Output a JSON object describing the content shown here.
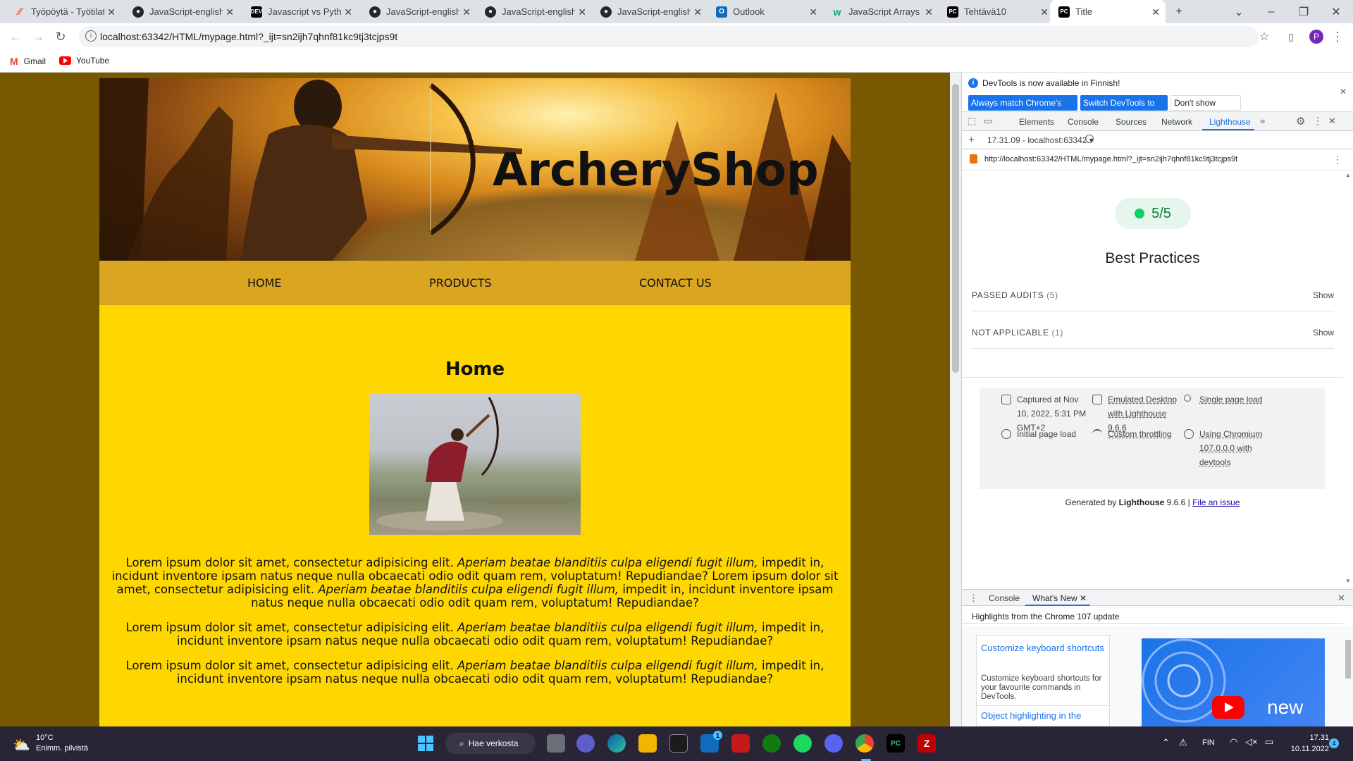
{
  "browser": {
    "tabs": [
      {
        "title": "Työpöytä - Työtilat",
        "icon": "trello-icon"
      },
      {
        "title": "JavaScript-english/",
        "icon": "github-icon"
      },
      {
        "title": "Javascript vs Python",
        "icon": "dev-icon"
      },
      {
        "title": "JavaScript-english/",
        "icon": "github-icon"
      },
      {
        "title": "JavaScript-english/",
        "icon": "github-icon"
      },
      {
        "title": "JavaScript-english/",
        "icon": "github-icon"
      },
      {
        "title": "Outlook",
        "icon": "outlook-icon"
      },
      {
        "title": "JavaScript Arrays",
        "icon": "w3schools-icon"
      },
      {
        "title": "Tehtävä10",
        "icon": "pycharm-icon"
      },
      {
        "title": "Title",
        "icon": "pycharm-icon"
      }
    ],
    "url": "localhost:63342/HTML/mypage.html?_ijt=sn2ijh7qhnf81kc9tj3tcjps9t",
    "profile_initial": "P",
    "bookmarks": [
      {
        "label": "Gmail",
        "icon": "gmail-icon"
      },
      {
        "label": "YouTube",
        "icon": "youtube-icon"
      }
    ]
  },
  "site": {
    "banner_title": "ArcheryShop",
    "nav": [
      "HOME",
      "PRODUCTS",
      "CONTACT US"
    ],
    "heading": "Home",
    "para_start": "Lorem ipsum dolor sit amet, consectetur adipisicing elit. ",
    "para_italic": "Aperiam beatae blanditiis culpa eligendi fugit illum,",
    "para_end": " impedit in, incidunt inventore ipsam natus neque nulla obcaecati odio odit quam rem, voluptatum! Repudiandae?"
  },
  "devtools": {
    "infobar_text": "DevTools is now available in Finnish!",
    "btn_match": "Always match Chrome's language",
    "btn_switch": "Switch DevTools to Finnish",
    "btn_dont_show": "Don't show again",
    "tabs": [
      "Elements",
      "Console",
      "Sources",
      "Network",
      "Lighthouse"
    ],
    "active_tab": "Lighthouse",
    "report_select": "17.31.09 - localhost:63342",
    "report_url": "http://localhost:63342/HTML/mypage.html?_ijt=sn2ijh7qhnf81kc9tj3tcjps9t",
    "score": "5/5",
    "category": "Best Practices",
    "passed_audits": "PASSED AUDITS",
    "passed_count": "(5)",
    "not_applicable": "NOT APPLICABLE",
    "na_count": "(1)",
    "show": "Show",
    "meta": {
      "captured": "Captured at Nov 10, 2022, 5:31 PM GMT+2",
      "emulated": "Emulated Desktop with Lighthouse 9.6.6",
      "single": "Single page load",
      "initial": "Initial page load",
      "throttling": "Custom throttling",
      "chromium": "Using Chromium 107.0.0.0 with devtools"
    },
    "generated_prefix": "Generated by ",
    "generated_name": "Lighthouse",
    "generated_version": " 9.6.6 | ",
    "file_issue": "File an issue",
    "drawer_tabs": [
      "Console",
      "What's New"
    ],
    "whats_new_heading": "Highlights from the Chrome 107 update",
    "card_title": "Customize keyboard shortcuts",
    "card_desc": "Customize keyboard shortcuts for your favourite commands in DevTools.",
    "card_next": "Object highlighting in the",
    "video_text": "new"
  },
  "taskbar": {
    "weather_temp": "10°C",
    "weather_desc": "Enimm. pilvistä",
    "search": "Hae verkosta",
    "lang": "FIN",
    "time": "17.31",
    "date": "10.11.2022",
    "notif_count": "4",
    "mail_badge": "1"
  }
}
